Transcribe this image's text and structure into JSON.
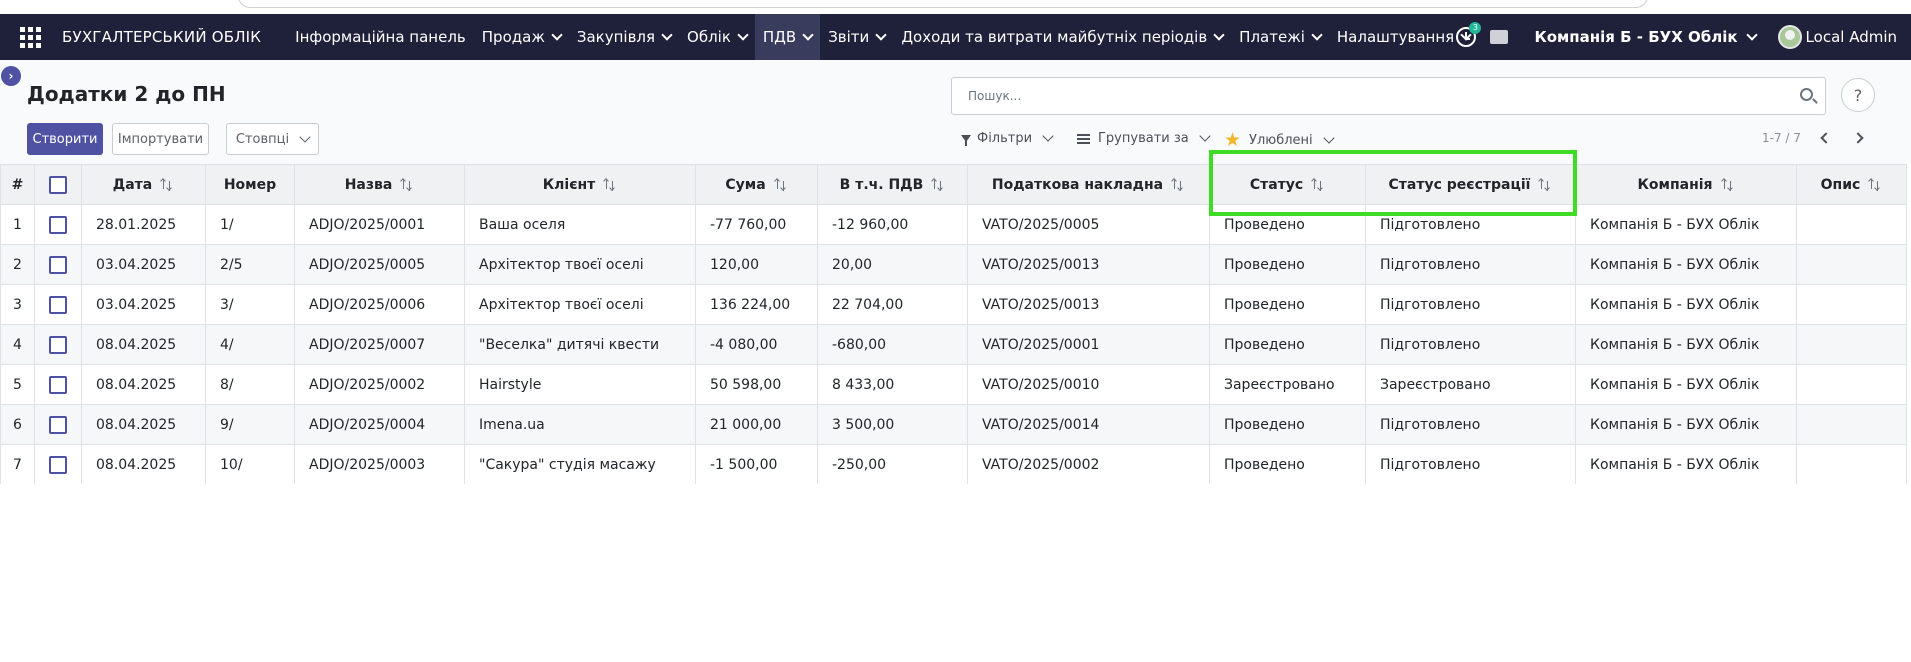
{
  "navbar": {
    "brand": "БУХГАЛТЕРСЬКИЙ ОБЛІК",
    "menu": [
      {
        "label": "Інформаційна панель",
        "dropdown": false,
        "active": false
      },
      {
        "label": "Продаж",
        "dropdown": true,
        "active": false
      },
      {
        "label": "Закупівля",
        "dropdown": true,
        "active": false
      },
      {
        "label": "Облік",
        "dropdown": true,
        "active": false
      },
      {
        "label": "ПДВ",
        "dropdown": true,
        "active": true
      },
      {
        "label": "Звіти",
        "dropdown": true,
        "active": false
      },
      {
        "label": "Доходи та витрати майбутніх періодів",
        "dropdown": true,
        "active": false
      },
      {
        "label": "Платежі",
        "dropdown": true,
        "active": false
      },
      {
        "label": "Налаштування",
        "dropdown": true,
        "active": false
      }
    ],
    "activity_badge": "3",
    "company": "Компанія Б - БУХ Облік",
    "user": "Local Admin",
    "icons": [
      "apps-grid-icon",
      "clock-icon",
      "chat-icon",
      "avatar-icon"
    ]
  },
  "page": {
    "title": "Додатки 2 до ПН",
    "create_label": "Створити",
    "import_label": "Імпортувати",
    "columns_label": "Стовпці",
    "search_placeholder": "Пошук...",
    "help_label": "?",
    "filters_label": "Фільтри",
    "group_label": "Групувати за",
    "favorites_label": "Улюблені",
    "pager": "1-7 / 7"
  },
  "table": {
    "headers": [
      "#",
      "",
      "Дата",
      "Номер",
      "Назва",
      "Клієнт",
      "Сума",
      "В т.ч. ПДВ",
      "Податкова накладна",
      "Статус",
      "Статус реєстрації",
      "Компанія",
      "Опис"
    ],
    "rows": [
      [
        "1",
        "28.01.2025",
        "1/",
        "ADJO/2025/0001",
        "Ваша оселя",
        "-77 760,00",
        "-12 960,00",
        "VATO/2025/0005",
        "Проведено",
        "Підготовлено",
        "Компанія Б - БУХ Облік",
        ""
      ],
      [
        "2",
        "03.04.2025",
        "2/5",
        "ADJO/2025/0005",
        "Архітектор твоєї оселі",
        "120,00",
        "20,00",
        "VATO/2025/0013",
        "Проведено",
        "Підготовлено",
        "Компанія Б - БУХ Облік",
        ""
      ],
      [
        "3",
        "03.04.2025",
        "3/",
        "ADJO/2025/0006",
        "Архітектор твоєї оселі",
        "136 224,00",
        "22 704,00",
        "VATO/2025/0013",
        "Проведено",
        "Підготовлено",
        "Компанія Б - БУХ Облік",
        ""
      ],
      [
        "4",
        "08.04.2025",
        "4/",
        "ADJO/2025/0007",
        "\"Веселка\" дитячі квести",
        "-4 080,00",
        "-680,00",
        "VATO/2025/0001",
        "Проведено",
        "Підготовлено",
        "Компанія Б - БУХ Облік",
        ""
      ],
      [
        "5",
        "08.04.2025",
        "8/",
        "ADJO/2025/0002",
        "Hairstyle",
        "50 598,00",
        "8 433,00",
        "VATO/2025/0010",
        "Зареєстровано",
        "Зареєстровано",
        "Компанія Б - БУХ Облік",
        ""
      ],
      [
        "6",
        "08.04.2025",
        "9/",
        "ADJO/2025/0004",
        "Imena.ua",
        "21 000,00",
        "3 500,00",
        "VATO/2025/0014",
        "Проведено",
        "Підготовлено",
        "Компанія Б - БУХ Облік",
        ""
      ],
      [
        "7",
        "08.04.2025",
        "10/",
        "ADJO/2025/0003",
        "\"Сакура\" студія масажу",
        "-1 500,00",
        "-250,00",
        "VATO/2025/0002",
        "Проведено",
        "Підготовлено",
        "Компанія Б - БУХ Облік",
        ""
      ]
    ]
  },
  "colors": {
    "navbar_bg": "#1f2039",
    "primary": "#4f51a3",
    "highlight": "#3fdc25"
  }
}
